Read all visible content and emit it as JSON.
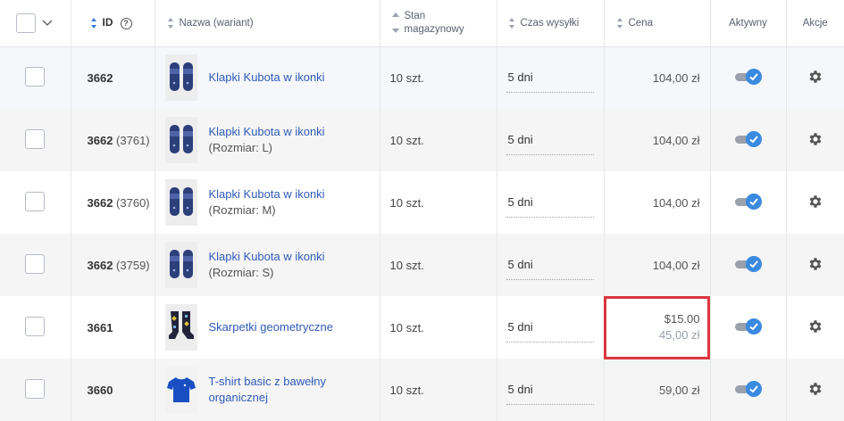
{
  "header": {
    "id_label": "ID",
    "name_label": "Nazwa (wariant)",
    "stock_label_line1": "Stan",
    "stock_label_line2": "magazynowy",
    "shipping_label": "Czas wysyłki",
    "price_label": "Cena",
    "active_label": "Aktywny",
    "actions_label": "Akcje"
  },
  "rows": [
    {
      "id": "3662",
      "variant_id": "",
      "name": "Klapki Kubota w ikonki",
      "variant": "",
      "stock": "10 szt.",
      "shipping": "5 dni",
      "price": "104,00 zł",
      "price_old": "",
      "thumb": "slippers-thumbnail",
      "active": true
    },
    {
      "id": "3662",
      "variant_id": "(3761)",
      "name": "Klapki Kubota w ikonki",
      "variant": "(Rozmiar: L)",
      "stock": "10 szt.",
      "shipping": "5 dni",
      "price": "104,00 zł",
      "price_old": "",
      "thumb": "slippers-thumbnail",
      "active": true
    },
    {
      "id": "3662",
      "variant_id": "(3760)",
      "name": "Klapki Kubota w ikonki",
      "variant": "(Rozmiar: M)",
      "stock": "10 szt.",
      "shipping": "5 dni",
      "price": "104,00 zł",
      "price_old": "",
      "thumb": "slippers-thumbnail",
      "active": true
    },
    {
      "id": "3662",
      "variant_id": "(3759)",
      "name": "Klapki Kubota w ikonki",
      "variant": "(Rozmiar: S)",
      "stock": "10 szt.",
      "shipping": "5 dni",
      "price": "104,00 zł",
      "price_old": "",
      "thumb": "slippers-thumbnail",
      "active": true
    },
    {
      "id": "3661",
      "variant_id": "",
      "name": "Skarpetki geometryczne",
      "variant": "",
      "stock": "10 szt.",
      "shipping": "5 dni",
      "price": "$15.00",
      "price_old": "45,00 zł",
      "thumb": "socks-thumbnail",
      "active": true
    },
    {
      "id": "3660",
      "variant_id": "",
      "name": "T-shirt basic z bawełny",
      "variant": "organicznej",
      "stock": "10 szt.",
      "shipping": "5 dni",
      "price": "59,00 zł",
      "price_old": "",
      "thumb": "tshirt-thumbnail",
      "active": true
    }
  ],
  "colors": {
    "link": "#2e5bb8",
    "toggle_on": "#3a8ae0",
    "highlight_border": "#d9373f"
  }
}
